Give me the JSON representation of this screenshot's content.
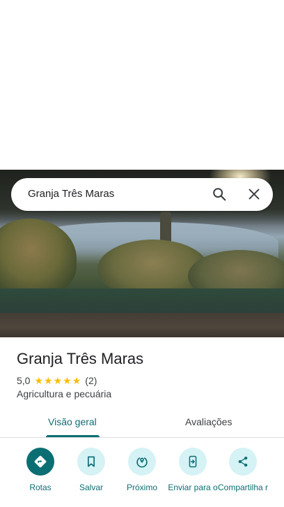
{
  "search": {
    "query": "Granja Três Maras"
  },
  "place": {
    "name": "Granja Três Maras",
    "rating": "5,0",
    "stars": 5,
    "review_count": "(2)",
    "category": "Agricultura e pecuária"
  },
  "tabs": [
    {
      "label": "Visão geral",
      "selected": true
    },
    {
      "label": "Avaliações",
      "selected": false
    }
  ],
  "actions": [
    {
      "label": "Rotas",
      "icon": "directions-icon"
    },
    {
      "label": "Salvar",
      "icon": "bookmark-icon"
    },
    {
      "label": "Próximo",
      "icon": "nearby-icon"
    },
    {
      "label": "Enviar para o",
      "icon": "send-to-phone-icon"
    },
    {
      "label": "Compartilha r",
      "icon": "share-icon"
    }
  ],
  "colors": {
    "accent": "#0b6e73",
    "accent_light": "#d5f2f5",
    "star": "#fbbc04"
  }
}
